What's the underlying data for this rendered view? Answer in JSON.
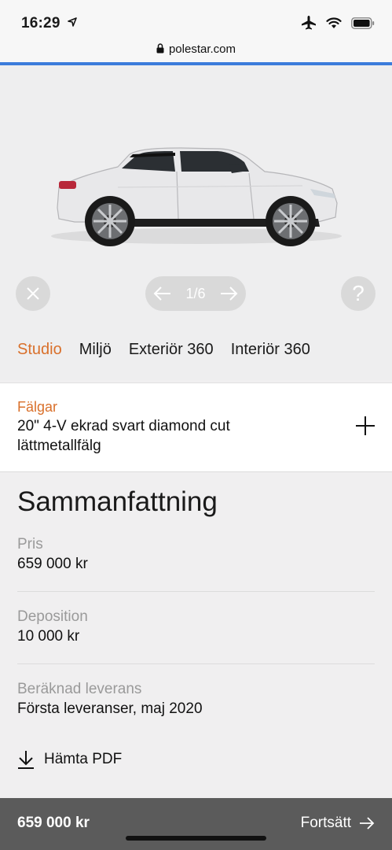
{
  "status_bar": {
    "time": "16:29",
    "url": "polestar.com"
  },
  "hero": {
    "pager_text": "1/6",
    "help_label": "?",
    "tabs": [
      {
        "label": "Studio",
        "active": true
      },
      {
        "label": "Miljö",
        "active": false
      },
      {
        "label": "Exteriör 360",
        "active": false
      },
      {
        "label": "Interiör 360",
        "active": false
      }
    ]
  },
  "option": {
    "label": "Fälgar",
    "value": "20\" 4-V ekrad svart diamond cut lättmetallfälg"
  },
  "summary": {
    "title": "Sammanfattning",
    "rows": [
      {
        "label": "Pris",
        "value": "659 000 kr"
      },
      {
        "label": "Deposition",
        "value": "10 000 kr"
      },
      {
        "label": "Beräknad leverans",
        "value": "Första leveranser, maj 2020"
      }
    ],
    "pdf_label": "Hämta PDF"
  },
  "bottom_bar": {
    "price": "659 000 kr",
    "continue_label": "Fortsätt"
  },
  "colors": {
    "accent": "#d9702b",
    "progress": "#3b7cdb",
    "bottom_bar": "#5b5b5b"
  },
  "icons": [
    "location-arrow-icon",
    "airplane-icon",
    "wifi-icon",
    "battery-icon",
    "lock-icon",
    "close-icon",
    "arrow-left-icon",
    "arrow-right-icon",
    "help-icon",
    "plus-icon",
    "download-icon"
  ]
}
